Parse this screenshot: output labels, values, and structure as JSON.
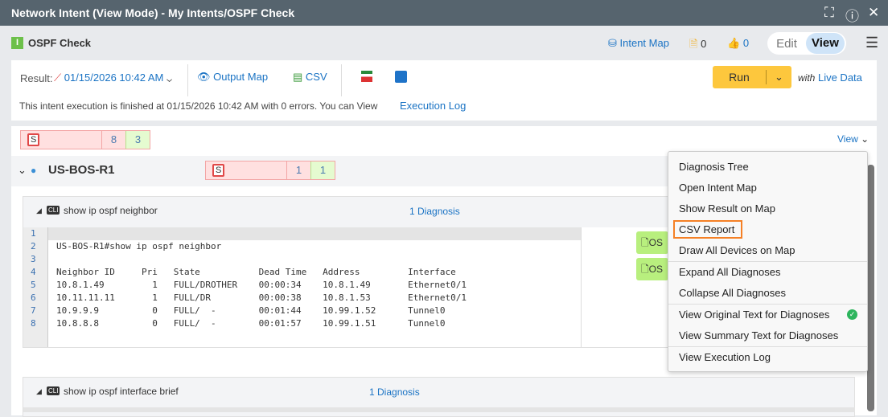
{
  "window": {
    "title": "Network Intent (View Mode) - My Intents/OSPF Check"
  },
  "header": {
    "name": "OSPF Check",
    "intent_map": "Intent Map",
    "notes_count": "0",
    "likes_count": "0",
    "edit": "Edit",
    "view": "View"
  },
  "toolbar": {
    "result_label": "Result:",
    "result_time": "01/15/2026 10:42 AM",
    "output_map": "Output Map",
    "csv": "CSV",
    "run": "Run",
    "with": "with",
    "live_data": "Live Data"
  },
  "status": {
    "message": "This intent execution is finished at 01/15/2026 10:42 AM with 0 errors. You can View",
    "link": "Execution Log"
  },
  "summary": {
    "s": "S",
    "fail": "8",
    "pass": "3",
    "view": "View"
  },
  "device": {
    "name": "US-BOS-R1",
    "s": "S",
    "fail": "1",
    "pass": "1"
  },
  "blocks": [
    {
      "command": "show ip ospf neighbor",
      "diagnosis": "1 Diagnosis",
      "lines": [
        "US-BOS-R1#show ip ospf neighbor",
        "",
        "Neighbor ID     Pri   State           Dead Time   Address         Interface",
        "10.8.1.49         1   FULL/DROTHER    00:00:34    10.8.1.49       Ethernet0/1",
        "10.11.11.11       1   FULL/DR         00:00:38    10.8.1.53       Ethernet0/1",
        "10.9.9.9          0   FULL/  -        00:01:44    10.99.1.52      Tunnel0",
        "10.8.8.8          0   FULL/  -        00:01:57    10.99.1.51      Tunnel0",
        ""
      ],
      "tags": [
        "OS",
        "OS"
      ]
    },
    {
      "command": "show ip ospf interface brief",
      "diagnosis": "1 Diagnosis"
    }
  ],
  "menu": {
    "items": [
      "Diagnosis Tree",
      "Open Intent Map",
      "Show Result on Map",
      "CSV Report",
      "Draw All Devices on Map",
      "Expand All Diagnoses",
      "Collapse All Diagnoses",
      "View Original Text for Diagnoses",
      "View Summary Text for Diagnoses",
      "View Execution Log"
    ]
  },
  "colors": {
    "titlebar": "#56646e",
    "run": "#fdc73d",
    "link": "#1a73c4",
    "highlight": "#f58025"
  }
}
